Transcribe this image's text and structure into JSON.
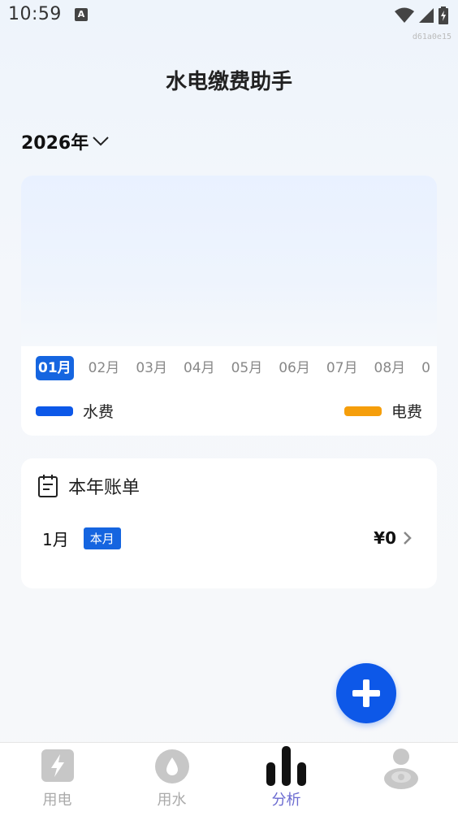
{
  "status_bar": {
    "time": "10:59",
    "notification_icon": "A",
    "build_id": "d61a0e15"
  },
  "app": {
    "title": "水电缴费助手"
  },
  "year_selector": {
    "value": "2026年"
  },
  "chart": {
    "months": [
      "01月",
      "02月",
      "03月",
      "04月",
      "05月",
      "06月",
      "07月",
      "08月",
      "0"
    ],
    "selected_index": 0,
    "legend": {
      "water": {
        "label": "水费",
        "color": "#0d58e8"
      },
      "electric": {
        "label": "电费",
        "color": "#f59e0b"
      }
    }
  },
  "bills": {
    "title": "本年账单",
    "rows": [
      {
        "month": "1月",
        "badge": "本月",
        "amount": "¥0"
      }
    ]
  },
  "fab": {
    "icon": "plus-icon"
  },
  "nav": {
    "items": [
      {
        "label": "用电",
        "icon": "lightning-icon"
      },
      {
        "label": "用水",
        "icon": "water-drop-icon"
      },
      {
        "label": "分析",
        "icon": "bar-chart-icon",
        "active": true
      },
      {
        "label": "",
        "icon": "profile-icon"
      }
    ]
  },
  "chart_data": {
    "type": "bar",
    "categories": [
      "01月",
      "02月",
      "03月",
      "04月",
      "05月",
      "06月",
      "07月",
      "08月"
    ],
    "series": [
      {
        "name": "水费",
        "values": []
      },
      {
        "name": "电费",
        "values": []
      }
    ]
  }
}
